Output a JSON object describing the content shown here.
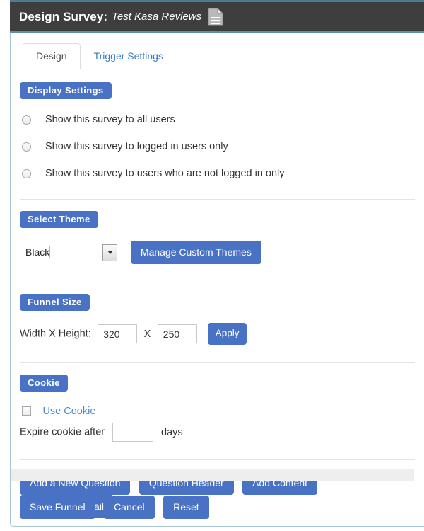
{
  "header": {
    "title": "Design Survey",
    "colon": ":",
    "subtitle": "Test Kasa Reviews",
    "doc_icon": "document-icon"
  },
  "tabs": [
    {
      "label": "Design",
      "active": true
    },
    {
      "label": "Trigger Settings",
      "active": false
    }
  ],
  "display_settings": {
    "section_label": "Display Settings",
    "options": [
      {
        "label": "Show this survey to all users",
        "checked": false
      },
      {
        "label": "Show this survey to logged in users only",
        "checked": false
      },
      {
        "label": "Show this survey to users who are not logged in only",
        "checked": false
      }
    ]
  },
  "select_theme": {
    "section_label": "Select Theme",
    "selected_theme": "Black",
    "manage_button": "Manage Custom Themes"
  },
  "funnel_size": {
    "section_label": "Funnel Size",
    "field_label": "Width X Height:",
    "width_value": "320",
    "separator": "X",
    "height_value": "250",
    "apply_button": "Apply"
  },
  "cookie": {
    "section_label": "Cookie",
    "use_cookie_label": "Use Cookie",
    "use_cookie_checked": false,
    "expire_label": "Expire cookie after",
    "expire_value": "",
    "days_label": "days"
  },
  "action_buttons": [
    "Add a New Question",
    "Question Header",
    "Add Content",
    "Add Name/Email"
  ],
  "footer_buttons": [
    "Save Funnel",
    "Cancel",
    "Reset"
  ],
  "colors": {
    "accent_blue": "#4a72c4",
    "header_dark": "#3e3e3e",
    "header_top_border": "#4d7a94",
    "header_bottom_border": "#5b93ad",
    "link_blue": "#3b7cc4",
    "panel_border": "#a8c4d4",
    "band_gray": "#eeeeee"
  }
}
